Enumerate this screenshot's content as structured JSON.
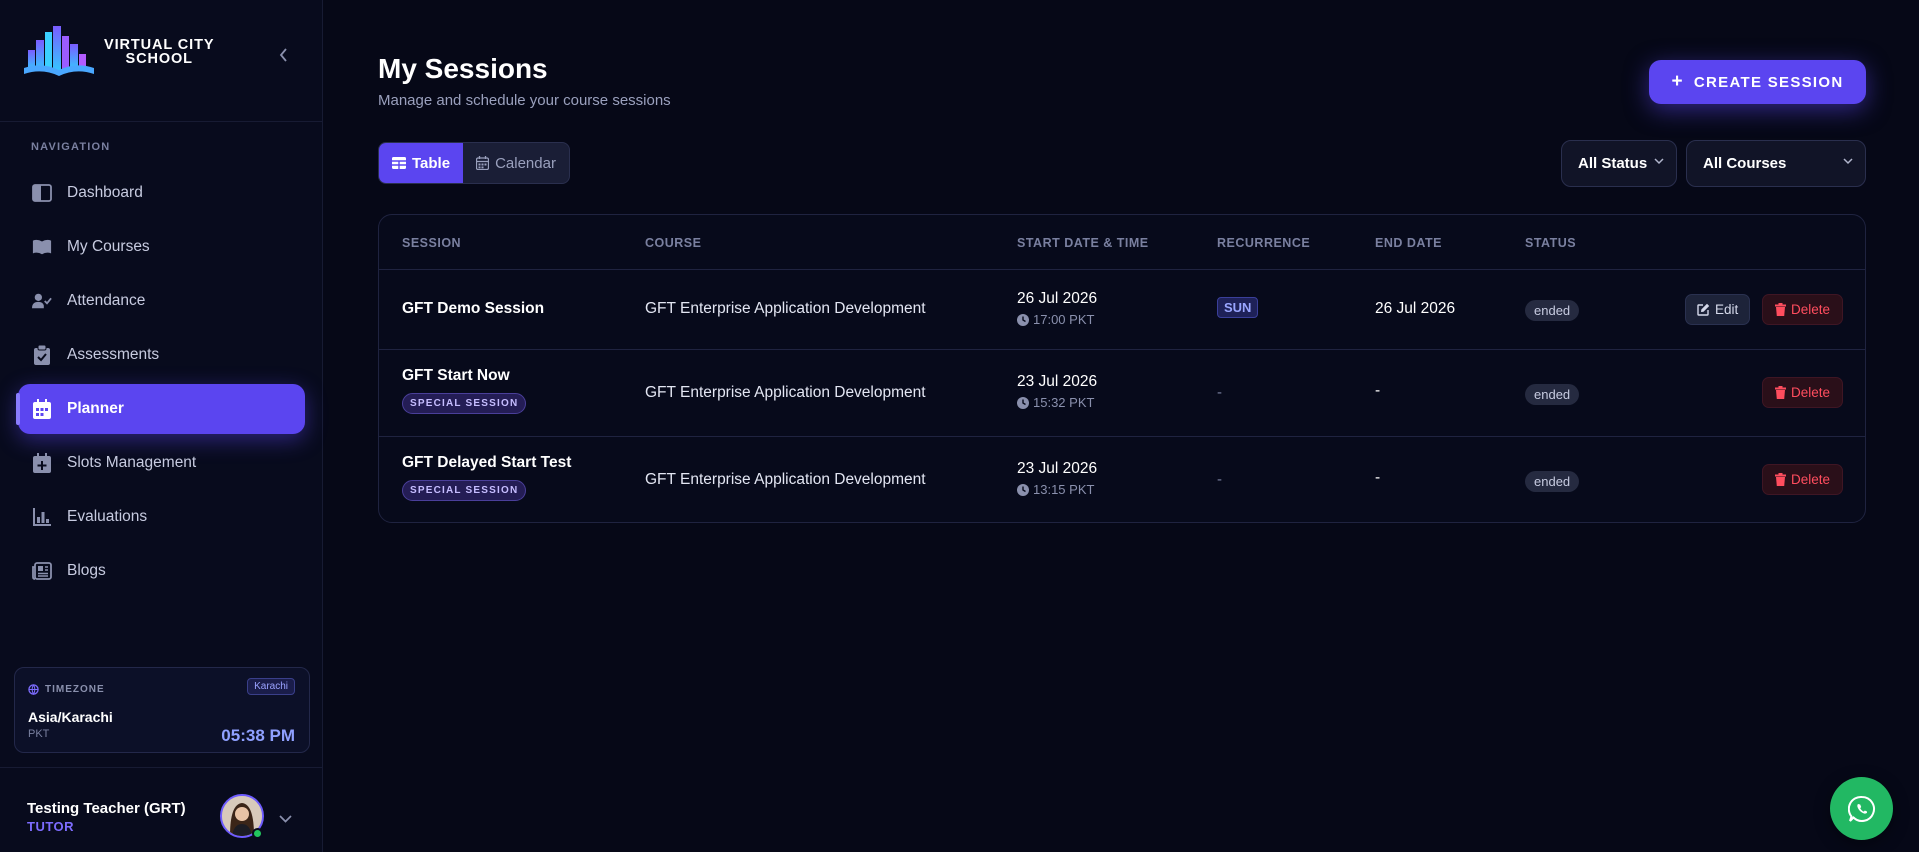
{
  "brand": {
    "line1": "VIRTUAL CITY",
    "line2": "SCHOOL"
  },
  "sidebar": {
    "nav_heading": "NAVIGATION",
    "items": [
      {
        "label": "Dashboard",
        "icon": "layout-icon"
      },
      {
        "label": "My Courses",
        "icon": "book-icon"
      },
      {
        "label": "Attendance",
        "icon": "user-check-icon"
      },
      {
        "label": "Assessments",
        "icon": "clipboard-icon"
      },
      {
        "label": "Planner",
        "icon": "calendar-icon",
        "active": true
      },
      {
        "label": "Slots Management",
        "icon": "calendar-plus-icon"
      },
      {
        "label": "Evaluations",
        "icon": "bar-chart-icon"
      },
      {
        "label": "Blogs",
        "icon": "newspaper-icon"
      }
    ]
  },
  "timezone": {
    "label": "TIMEZONE",
    "badge": "Karachi",
    "name": "Asia/Karachi",
    "abbr": "PKT",
    "time": "05:38 PM"
  },
  "user": {
    "name": "Testing Teacher (GRT)",
    "role": "TUTOR"
  },
  "header": {
    "title": "My Sessions",
    "subtitle": "Manage and schedule your course sessions",
    "create_label": "CREATE SESSION"
  },
  "view_toggle": {
    "table_label": "Table",
    "calendar_label": "Calendar",
    "selected": "Table"
  },
  "filters": {
    "status": "All Status",
    "courses": "All Courses"
  },
  "table": {
    "columns": [
      "SESSION",
      "COURSE",
      "START DATE & TIME",
      "RECURRENCE",
      "END DATE",
      "STATUS"
    ],
    "rows": [
      {
        "session": "GFT Demo Session",
        "tag": "",
        "course": "GFT Enterprise Application Development",
        "start_date": "26 Jul 2026",
        "start_time": "17:00 PKT",
        "recurrence": "SUN",
        "end_date": "26 Jul 2026",
        "status": "ended",
        "edit_label": "Edit",
        "delete_label": "Delete"
      },
      {
        "session": "GFT Start Now",
        "tag": "SPECIAL SESSION",
        "course": "GFT Enterprise Application Development",
        "start_date": "23 Jul 2026",
        "start_time": "15:32 PKT",
        "recurrence": "-",
        "end_date": "-",
        "status": "ended",
        "edit_label": "",
        "delete_label": "Delete"
      },
      {
        "session": "GFT Delayed Start Test",
        "tag": "SPECIAL SESSION",
        "course": "GFT Enterprise Application Development",
        "start_date": "23 Jul 2026",
        "start_time": "13:15 PKT",
        "recurrence": "-",
        "end_date": "-",
        "status": "ended",
        "edit_label": "",
        "delete_label": "Delete"
      }
    ]
  },
  "colors": {
    "accent": "#5b45f0",
    "background": "#060817",
    "danger": "#ff4d5e",
    "whatsapp": "#22b863"
  }
}
